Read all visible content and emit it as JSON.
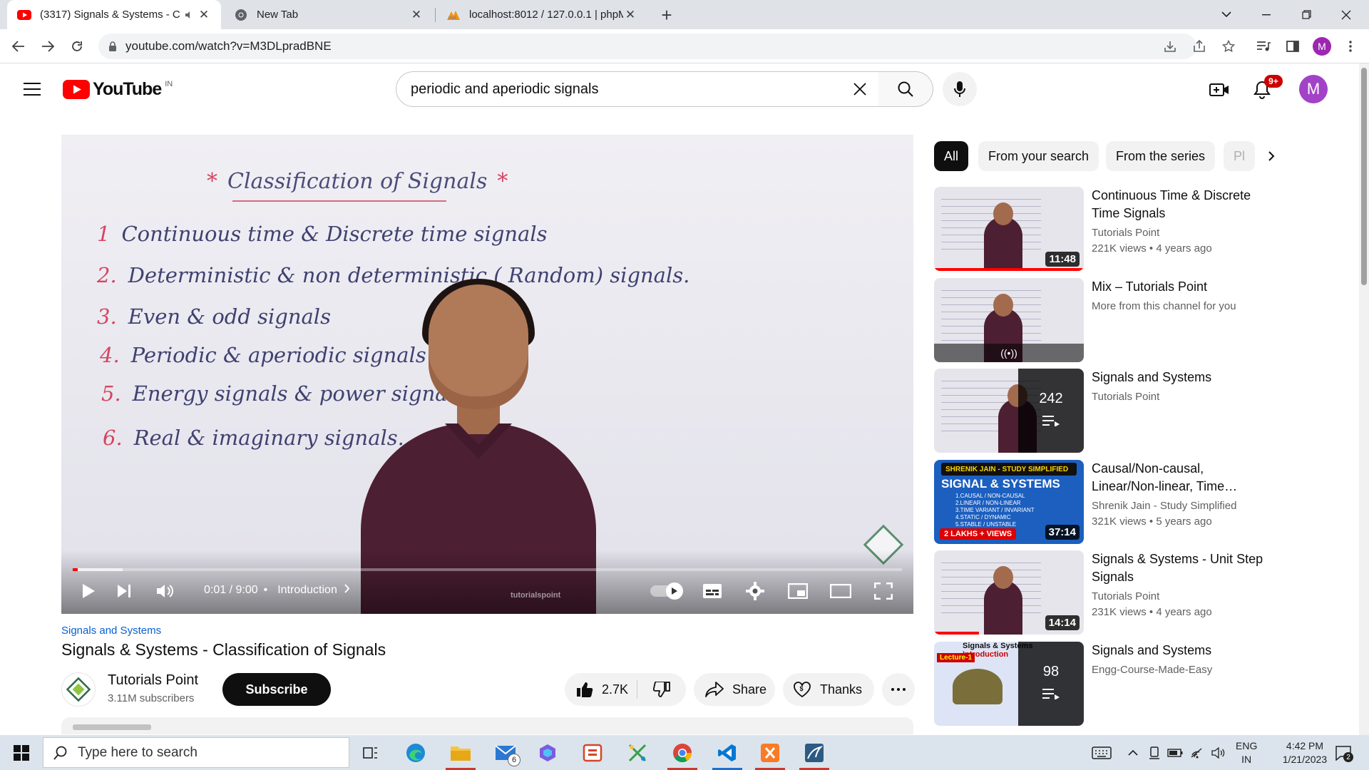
{
  "browser": {
    "tabs": [
      {
        "title": "(3317) Signals & Systems - C",
        "icon": "youtube-icon",
        "active": true
      },
      {
        "title": "New Tab",
        "icon": "chrome-icon",
        "active": false
      },
      {
        "title": "localhost:8012 / 127.0.0.1 | phpM",
        "icon": "phpmyadmin-icon",
        "active": false
      }
    ],
    "url": "youtube.com/watch?v=M3DLpradBNE",
    "profile_initial": "M"
  },
  "youtube": {
    "logo_text": "YouTube",
    "country_code": "IN",
    "search_query": "periodic and aperiodic signals",
    "notification_count": "9+",
    "avatar_initial": "M"
  },
  "player": {
    "board_title": "Classification of Signals",
    "board_items": [
      {
        "num": "1",
        "text": "Continuous time & Discrete time signals"
      },
      {
        "num": "2.",
        "text": "Deterministic & non deterministic ( Random) signals."
      },
      {
        "num": "3.",
        "text": "Even & odd signals"
      },
      {
        "num": "4.",
        "text": "Periodic & aperiodic signals"
      },
      {
        "num": "5.",
        "text": "Energy signals & power signals."
      },
      {
        "num": "6.",
        "text": "Real & imaginary signals."
      }
    ],
    "shirt_brand": "tutorialspoint",
    "time": "0:01 / 9:00",
    "chapter": "Introduction",
    "progress_fraction": 0.0019,
    "buffer_fraction": 0.06
  },
  "video": {
    "series": "Signals and Systems",
    "title": "Signals & Systems - Classification of Signals",
    "channel": "Tutorials Point",
    "subscribers": "3.11M subscribers",
    "subscribe_label": "Subscribe",
    "likes": "2.7K",
    "share_label": "Share",
    "thanks_label": "Thanks"
  },
  "filters": {
    "chips": [
      "All",
      "From your search",
      "From the series",
      "Pl"
    ]
  },
  "recommendations": [
    {
      "title": "Continuous Time & Discrete Time Signals",
      "channel": "Tutorials Point",
      "views": "221K views",
      "age": "4 years ago",
      "duration": "11:48",
      "watched_fraction": 1.0
    },
    {
      "title": "Mix – Tutorials Point",
      "channel": "More from this channel for you",
      "views": "",
      "age": "",
      "duration": "",
      "watched_fraction": 0
    },
    {
      "title": "Signals and Systems",
      "channel": "Tutorials Point",
      "views": "",
      "age": "",
      "playlist_count": "242"
    },
    {
      "title": "Causal/Non-causal, Linear/Non-linear, Time Variant/Invariant,...",
      "channel": "Shrenik Jain - Study Simplified",
      "views": "321K views",
      "age": "5 years ago",
      "duration": "37:14",
      "banner": "SHRENIK JAIN - STUDY SIMPLIFIED",
      "big_label": "SIGNAL & SYSTEMS",
      "topics": "1.CAUSAL / NON-CAUSAL\n2.LINEAR / NON-LINEAR\n3.TIME VARIANT / INVARIANT\n4.STATIC / DYNAMIC\n5.STABLE / UNSTABLE",
      "views_tag": "2 LAKHS + VIEWS"
    },
    {
      "title": "Signals & Systems - Unit Step Signals",
      "channel": "Tutorials Point",
      "views": "231K views",
      "age": "4 years ago",
      "duration": "14:14",
      "watched_fraction": 0.3
    },
    {
      "title": "Signals and Systems",
      "channel": "Engg-Course-Made-Easy",
      "views": "",
      "age": "",
      "playlist_count": "98",
      "lecture_tag": "Lecture-1",
      "lecture_title": "Signals & Systems",
      "lecture_sub": "Introduction"
    }
  ],
  "taskbar": {
    "search_placeholder": "Type here to search",
    "mail_badge": "6",
    "language": "ENG",
    "region": "IN",
    "time": "4:42 PM",
    "date": "1/21/2023",
    "notification_count": "2"
  }
}
